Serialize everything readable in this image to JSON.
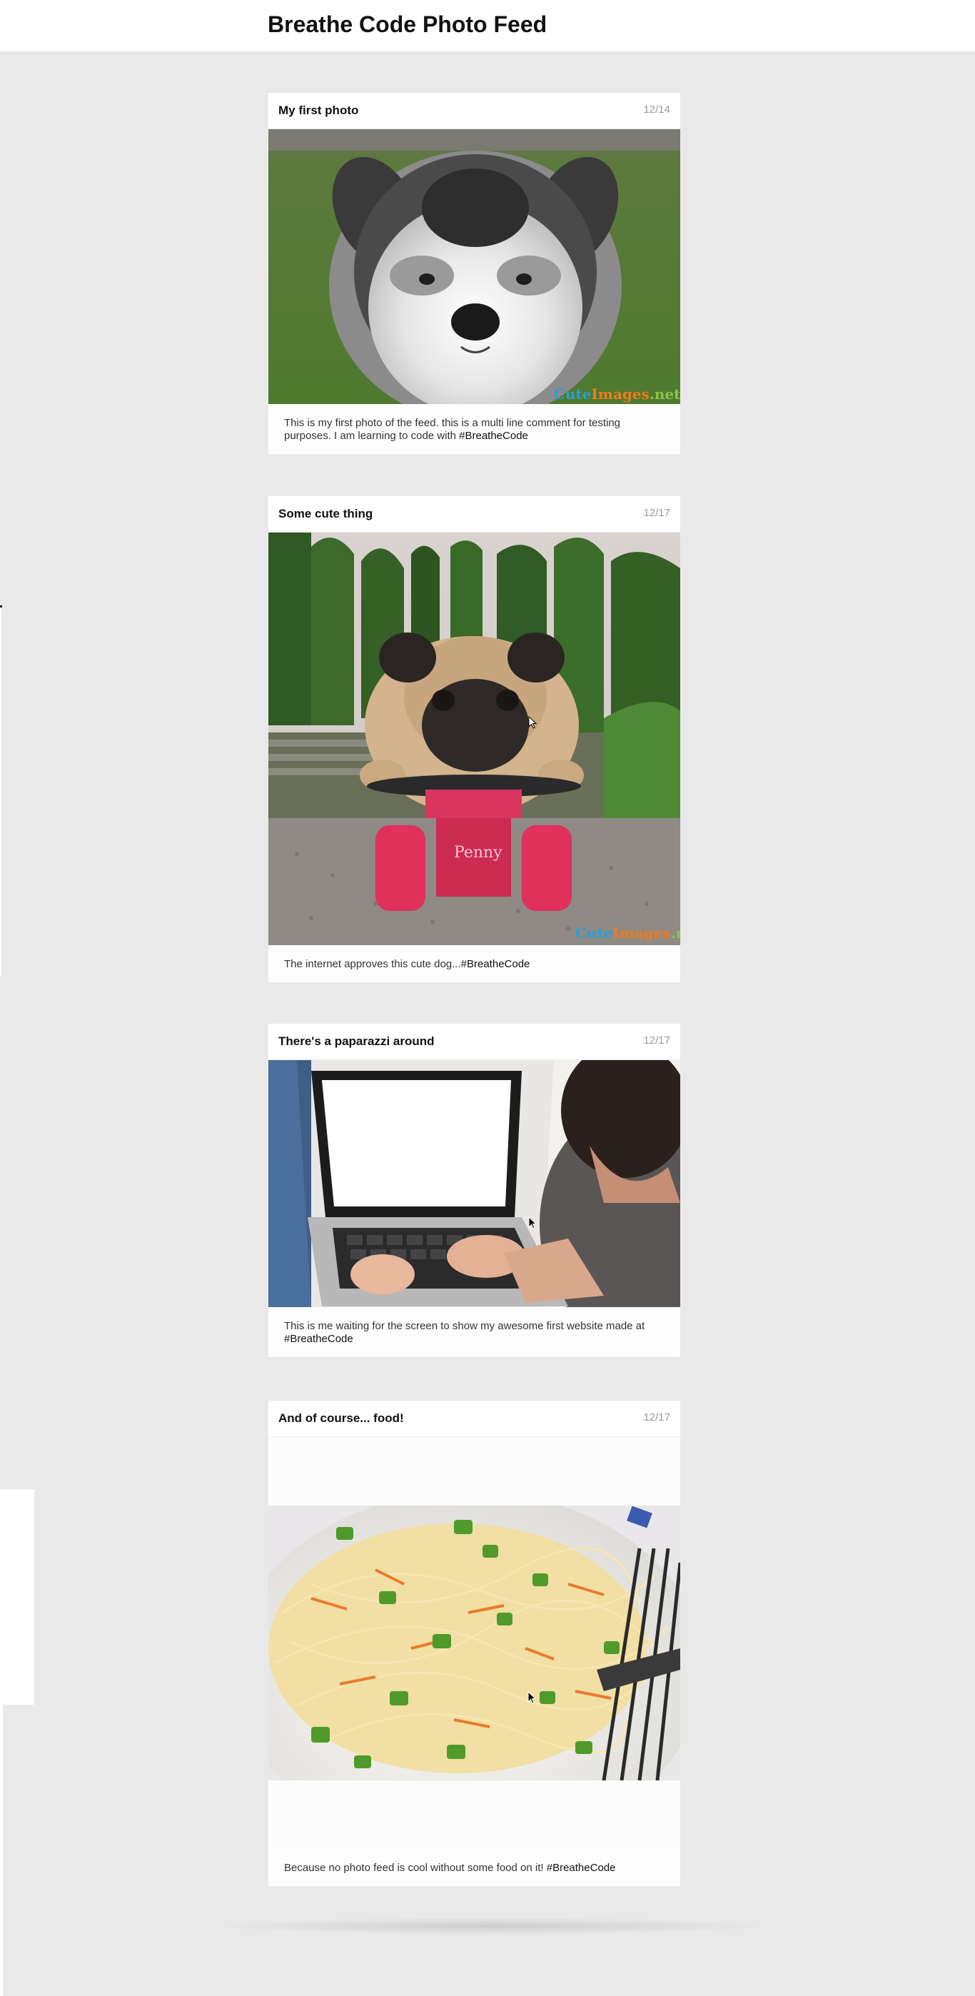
{
  "app": {
    "title": "Breathe Code Photo Feed"
  },
  "posts": [
    {
      "title": "My first photo",
      "date": "12/14",
      "photo": "husky-puppy",
      "caption": "This is my first photo of the feed. this is a multi line comment for testing purposes. I am learning to code with ",
      "tag": "#BreatheCode"
    },
    {
      "title": "Some cute thing",
      "date": "12/17",
      "photo": "pug-on-skateboard",
      "caption": "The internet approves this cute dog...",
      "tag": "#BreatheCode"
    },
    {
      "title": "There's a paparazzi around",
      "date": "12/17",
      "photo": "woman-typing-on-laptop",
      "caption": "This is me waiting for the screen to show my awesome first website made at ",
      "tag": "#BreatheCode"
    },
    {
      "title": "And of course... food!",
      "date": "12/17",
      "photo": "noodles-with-vegetables",
      "caption": "Because no photo feed is cool without some food on it! ",
      "tag": "#BreatheCode"
    }
  ],
  "watermark": {
    "part1": "Cute",
    "part2": "Images",
    "part3": ".net",
    "colors": [
      "#2a9fd6",
      "#f07a1a",
      "#8bc34a"
    ]
  },
  "skateboard_brand": "Penny",
  "colors": {
    "background": "#e9e9e9",
    "card": "#ffffff",
    "date": "#999999"
  }
}
